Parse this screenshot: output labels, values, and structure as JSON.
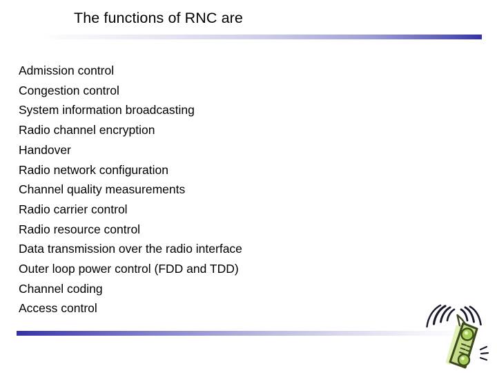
{
  "slide": {
    "title": "The functions of RNC are",
    "background_color": "#ffffff",
    "accent_color": "#3331a8",
    "text_color": "#000000",
    "bullets": [
      "Admission control",
      "Congestion control",
      "System information broadcasting",
      "Radio channel encryption",
      "Handover",
      "Radio network configuration",
      "Channel quality measurements",
      "Radio carrier control",
      "Radio resource control",
      "Data transmission over the radio interface",
      "Outer loop power control (FDD and TDD)",
      "Channel coding",
      "Access control"
    ],
    "decorations": {
      "title_rule_name": "title-gradient-rule",
      "footer_rule_name": "footer-gradient-rule"
    },
    "graphic": {
      "name": "mobile-phone-icon",
      "body_color": "#c5dd8a",
      "body_highlight": "#e4f0c3",
      "outline_color": "#3c4a1e",
      "button_color": "#a8cf56",
      "wave_color": "#1a1a2e"
    }
  }
}
